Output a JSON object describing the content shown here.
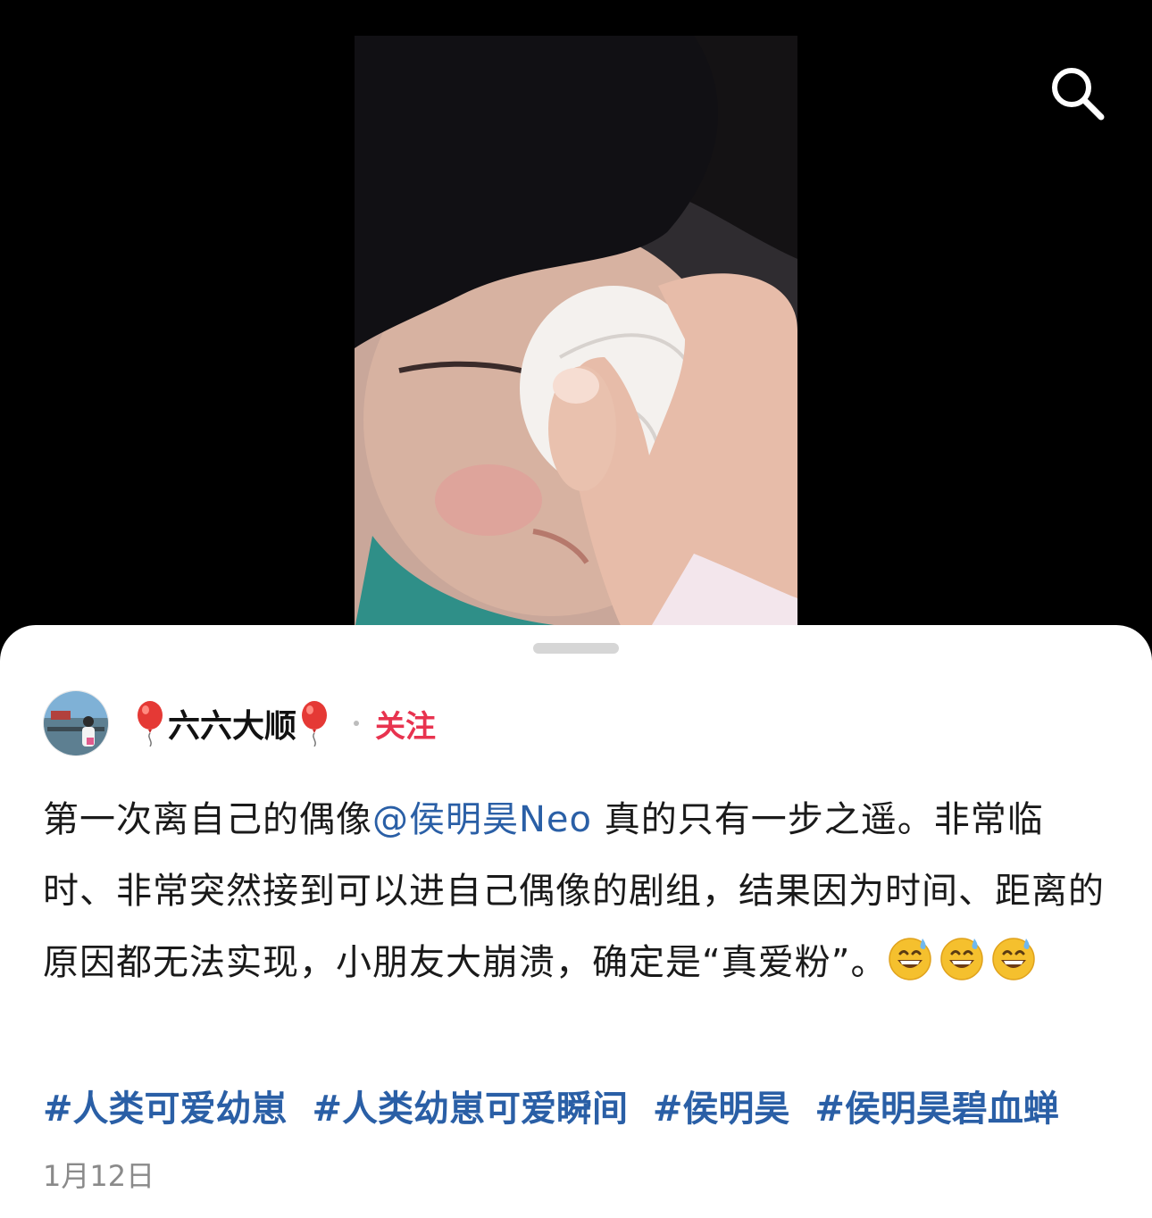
{
  "header": {
    "search_icon": "search-icon"
  },
  "post": {
    "author": {
      "name_prefix_icon": "red-balloon-icon",
      "name": "六六大顺",
      "name_suffix_icon": "red-balloon-icon",
      "follow_label": "关注"
    },
    "text": {
      "part1": "第一次离自己的偶像",
      "mention": "@侯明昊Neo",
      "part2": " 真的只有一步之遥。非常临时、非常突然接到可以进自己偶像的剧组，结果因为时间、距离的原因都无法实现，小朋友大崩溃，确定是“真爱粉”。",
      "emojis": [
        "grinning-sweat-emoji",
        "grinning-sweat-emoji",
        "grinning-sweat-emoji"
      ]
    },
    "tags": [
      "#人类可爱幼崽",
      "#人类幼崽可爱瞬间",
      "#侯明昊",
      "#侯明昊碧血蝉"
    ],
    "date": "1月12日"
  },
  "colors": {
    "follow": "#e8334f",
    "link": "#2a5fa6",
    "date": "#8a8a8a"
  }
}
